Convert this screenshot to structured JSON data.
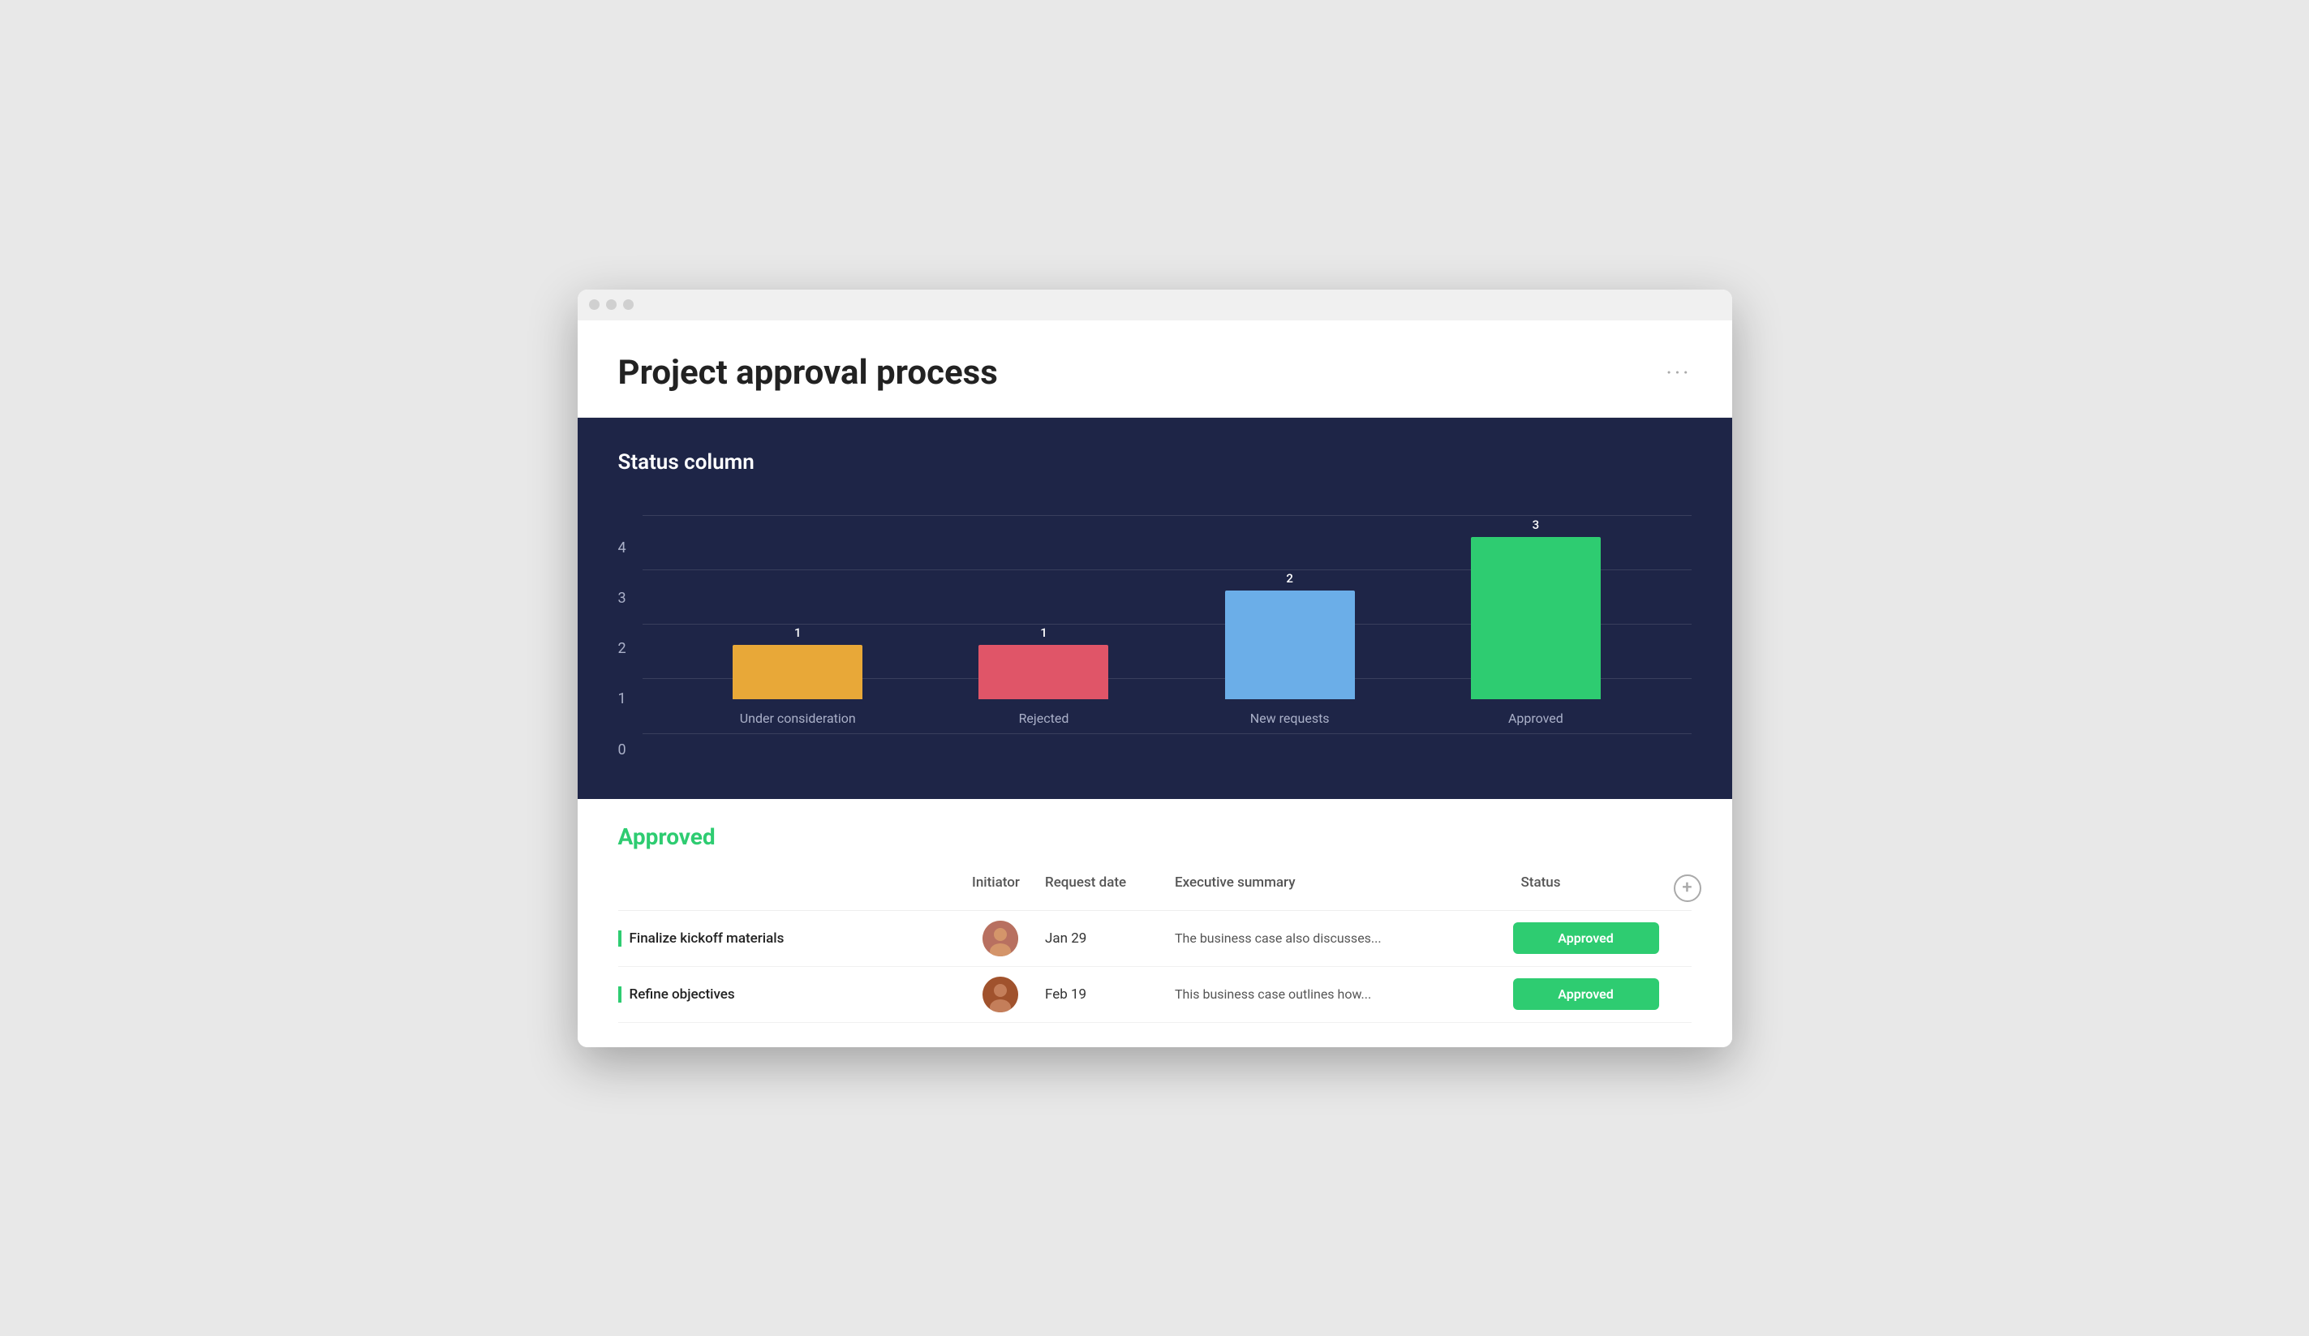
{
  "window": {
    "title": "Project approval process"
  },
  "header": {
    "title": "Project approval process",
    "more_label": "···"
  },
  "chart": {
    "title": "Status column",
    "y_labels": [
      "0",
      "1",
      "2",
      "3",
      "4"
    ],
    "bars": [
      {
        "label": "Under consideration",
        "value": 1,
        "color": "#e8a838",
        "height_pct": 25
      },
      {
        "label": "Rejected",
        "value": 1,
        "color": "#e05568",
        "height_pct": 25
      },
      {
        "label": "New requests",
        "value": 2,
        "color": "#6baee8",
        "height_pct": 50
      },
      {
        "label": "Approved",
        "value": 3,
        "color": "#2ecc71",
        "height_pct": 75
      }
    ]
  },
  "approved_section": {
    "heading": "Approved",
    "columns": {
      "name": "",
      "initiator": "Initiator",
      "request_date": "Request date",
      "executive_summary": "Executive summary",
      "status": "Status",
      "add": ""
    },
    "rows": [
      {
        "name": "Finalize kickoff materials",
        "initiator": "avatar1",
        "date": "Jan 29",
        "summary": "The business case also discusses...",
        "status": "Approved"
      },
      {
        "name": "Refine objectives",
        "initiator": "avatar2",
        "date": "Feb 19",
        "summary": "This business case outlines how...",
        "status": "Approved"
      }
    ]
  }
}
